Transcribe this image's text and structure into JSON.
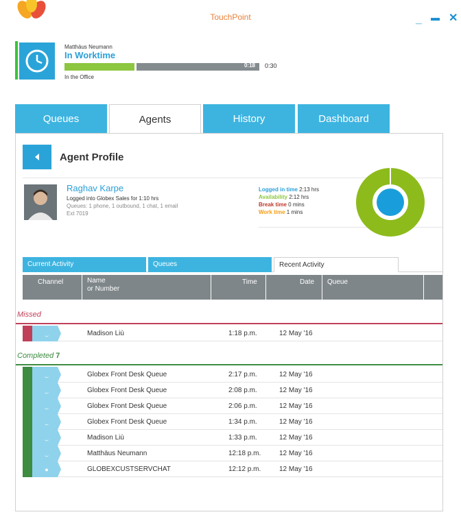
{
  "app": {
    "title": "TouchPoint"
  },
  "window_buttons": {
    "minimize": "_",
    "maximize": "▬",
    "close": "✕"
  },
  "status": {
    "user_name": "Matthäus Neumann",
    "state": "In Worktime",
    "elapsed": "0:18",
    "limit": "0:30",
    "progress_fraction": 0.6,
    "location": "In the Office"
  },
  "tabs": [
    {
      "label": "Queues"
    },
    {
      "label": "Agents"
    },
    {
      "label": "History"
    },
    {
      "label": "Dashboard"
    }
  ],
  "profile": {
    "header": "Agent Profile",
    "name": "Raghav Karpe",
    "logged_into": "Logged into Globex Sales for 1:10 hrs",
    "queues": "Queues: 1 phone, 1 outbound, 1 chat, 1 email",
    "ext": "Ext 7019",
    "stats": [
      {
        "label": "Logged in time",
        "value": "2:13 hrs",
        "color": "#2a9fd8"
      },
      {
        "label": "Availability",
        "value": "2:12 hrs",
        "color": "#8dc63f"
      },
      {
        "label": "Break time",
        "value": "0 mins",
        "color": "#c0392b"
      },
      {
        "label": "Work time",
        "value": "1 mins",
        "color": "#f39c12"
      }
    ]
  },
  "subtabs": [
    {
      "label": "Current Activity"
    },
    {
      "label": "Queues"
    },
    {
      "label": "Recent Activity"
    }
  ],
  "table": {
    "headers": {
      "channel": "Channel",
      "name": "Name",
      "name2": "or Number",
      "time": "Time",
      "date": "Date",
      "queue": "Queue"
    }
  },
  "groups": {
    "missed": {
      "label": "Missed",
      "color": "#c0405a"
    },
    "completed": {
      "label": "Completed",
      "count": "7",
      "color": "#3d8c40"
    }
  },
  "missed_rows": [
    {
      "icon": "phone-icon",
      "name": "Madison Liù",
      "time": "1:18 p.m.",
      "date": "12 May '16"
    }
  ],
  "completed_rows": [
    {
      "icon": "phone-icon",
      "name": "Globex Front Desk Queue",
      "time": "2:17 p.m.",
      "date": "12 May '16"
    },
    {
      "icon": "phone-icon",
      "name": "Globex Front Desk Queue",
      "time": "2:08 p.m.",
      "date": "12 May '16"
    },
    {
      "icon": "phone-icon",
      "name": "Globex Front Desk Queue",
      "time": "2:06 p.m.",
      "date": "12 May '16"
    },
    {
      "icon": "phone-icon",
      "name": "Globex Front Desk Queue",
      "time": "1:34 p.m.",
      "date": "12 May '16"
    },
    {
      "icon": "phone-icon",
      "name": "Madison Liù",
      "time": "1:33 p.m.",
      "date": "12 May '16"
    },
    {
      "icon": "phone-icon",
      "name": "Matthäus Neumann",
      "time": "12:18 p.m.",
      "date": "12 May '16"
    },
    {
      "icon": "chat-icon",
      "name": "GLOBEXCUSTSERVCHAT",
      "time": "12:12 p.m.",
      "date": "12 May '16"
    }
  ]
}
